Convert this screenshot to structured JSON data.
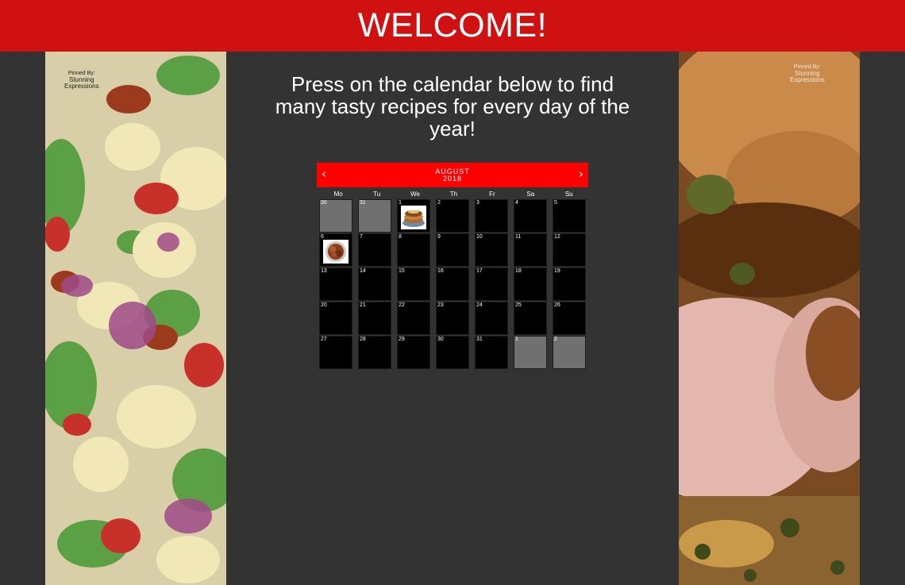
{
  "banner": {
    "title": "WELCOME!"
  },
  "intro": {
    "text": "Press on the calendar below to find many tasty recipes for every day of the year!"
  },
  "watermark": {
    "pinned_by": "Pinned By:",
    "brand_line1": "Stunning",
    "brand_line2": "Expressions"
  },
  "calendar": {
    "month": "AUGUST",
    "year": "2018",
    "prev_icon": "‹",
    "next_icon": "›",
    "weekdays": [
      "Mo",
      "Tu",
      "We",
      "Th",
      "Fr",
      "Sa",
      "Su"
    ],
    "days": [
      {
        "n": "30",
        "other": true
      },
      {
        "n": "31",
        "other": true
      },
      {
        "n": "1",
        "recipe": "pancakes"
      },
      {
        "n": "2"
      },
      {
        "n": "3"
      },
      {
        "n": "4"
      },
      {
        "n": "5"
      },
      {
        "n": "6",
        "recipe": "glazed-meat"
      },
      {
        "n": "7"
      },
      {
        "n": "8"
      },
      {
        "n": "9"
      },
      {
        "n": "10"
      },
      {
        "n": "11"
      },
      {
        "n": "12"
      },
      {
        "n": "13"
      },
      {
        "n": "14"
      },
      {
        "n": "15"
      },
      {
        "n": "16"
      },
      {
        "n": "17"
      },
      {
        "n": "18"
      },
      {
        "n": "19"
      },
      {
        "n": "20"
      },
      {
        "n": "21"
      },
      {
        "n": "22"
      },
      {
        "n": "23"
      },
      {
        "n": "24"
      },
      {
        "n": "25"
      },
      {
        "n": "26"
      },
      {
        "n": "27"
      },
      {
        "n": "28"
      },
      {
        "n": "29"
      },
      {
        "n": "30"
      },
      {
        "n": "31"
      },
      {
        "n": "1",
        "other": true
      },
      {
        "n": "2",
        "other": true
      }
    ]
  },
  "colors": {
    "banner": "#cf1111",
    "calendar_header": "#ff0000",
    "background": "#333333",
    "other_month_day": "#707070"
  }
}
